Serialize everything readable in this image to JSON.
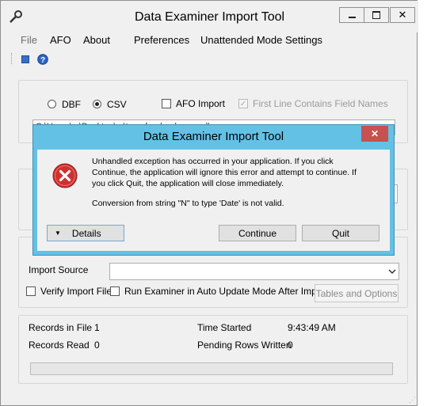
{
  "window": {
    "title": "Data Examiner Import Tool"
  },
  "menu": [
    "File",
    "AFO",
    "About",
    "Preferences",
    "Unattended Mode Settings"
  ],
  "source": {
    "dbf_label": "DBF",
    "csv_label": "CSV",
    "csv_selected": true,
    "afo_import_label": "AFO Import",
    "first_line_label": "First Line Contains Field Names",
    "file_path": "C:\\Users\\...\\Desktop\\...\\transfer_bank_overall"
  },
  "import": {
    "import_source_label": "Import Source",
    "import_source_value": "",
    "verify_label": "Verify Import File",
    "auto_update_label": "Run Examiner in Auto Update Mode After Import",
    "tables_button": "Tables and Options"
  },
  "stats": {
    "records_in_file_label": "Records in File",
    "records_in_file": "1",
    "records_read_label": "Records Read",
    "records_read": "0",
    "time_started_label": "Time Started",
    "time_started": "9:43:49 AM",
    "pending_label": "Pending Rows Written",
    "pending": "0",
    "progress": 0
  },
  "dialog": {
    "title": "Data Examiner Import Tool",
    "message_line1": "Unhandled exception has occurred in your application. If you click",
    "message_line2": "Continue, the application will ignore this error and attempt to continue. If",
    "message_line3": "you click Quit, the application will close immediately.",
    "detail": "Conversion from string \"N\" to type 'Date' is not valid.",
    "details_button": "Details",
    "continue_button": "Continue",
    "quit_button": "Quit"
  },
  "colors": {
    "dialog_frame": "#63c1e5",
    "close_red": "#c75050",
    "error_red": "#d32f2f"
  },
  "icons": [
    "wrench-icon",
    "minimize-icon",
    "maximize-icon",
    "close-icon",
    "toolbar-square-icon",
    "help-icon",
    "error-icon",
    "chevron-down-icon"
  ]
}
